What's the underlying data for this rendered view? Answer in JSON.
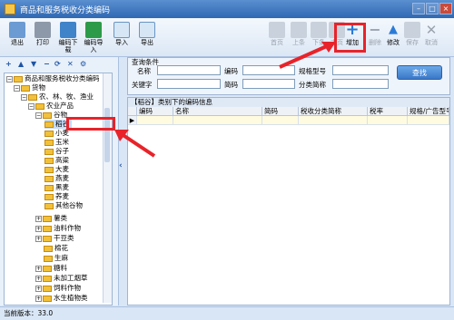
{
  "window": {
    "title": "商品和服务税收分类编码"
  },
  "toolbar": {
    "exit": "退出",
    "print": "打印",
    "code_download": "编码下载",
    "code_import": "编码导入",
    "import": "导入",
    "export": "导出",
    "first": "首页",
    "prev": "上条",
    "next": "下条",
    "last": "末页",
    "add": "增加",
    "delete": "删除",
    "modify": "修改",
    "save": "保存",
    "cancel": "取消"
  },
  "tree": {
    "root": "商品和服务税收分类编码",
    "n1": "货物",
    "n2": "农、林、牧、渔业",
    "n3": "农业产品",
    "n4": "谷物",
    "items": [
      "稻谷",
      "小麦",
      "玉米",
      "谷子",
      "高粱",
      "大麦",
      "燕麦",
      "黑麦",
      "荞麦",
      "其他谷物"
    ],
    "others": [
      "薯类",
      "油料作物",
      "干豆类",
      "棉花",
      "生麻",
      "糖料",
      "未加工烟草",
      "饲料作物",
      "水生植物类"
    ]
  },
  "query": {
    "title": "查询条件",
    "name_label": "名称",
    "code_label": "编码",
    "spec_label": "规格型号",
    "keyword_label": "关键字",
    "shortcode_label": "简码",
    "category_label": "分类简称",
    "exec_button": "查找"
  },
  "grid": {
    "title": "【稻谷】类别下的编码信息",
    "columns": [
      "编码",
      "名称",
      "简码",
      "税收分类简称",
      "税率",
      "规格/广告型号"
    ]
  },
  "status": {
    "version": "当前版本：33.0"
  }
}
